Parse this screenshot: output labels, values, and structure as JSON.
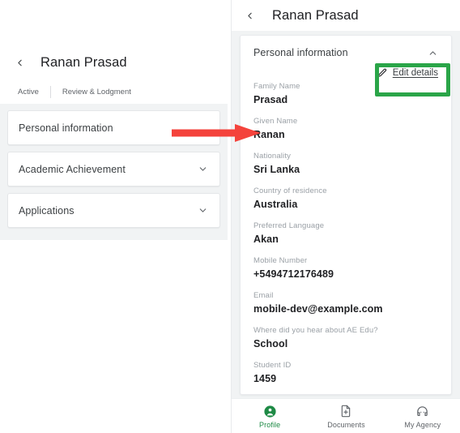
{
  "left_screen": {
    "back_icon": "chevron-left-icon",
    "title": "Ranan Prasad",
    "tabs": [
      {
        "label": "Active"
      },
      {
        "label": "Review & Lodgment"
      }
    ],
    "sections": [
      {
        "label": "Personal information",
        "icon": ""
      },
      {
        "label": "Academic Achievement",
        "icon": "chevron-down-icon"
      },
      {
        "label": "Applications",
        "icon": "chevron-down-icon"
      }
    ]
  },
  "right_screen": {
    "back_icon": "chevron-left-icon",
    "title": "Ranan Prasad",
    "card": {
      "title": "Personal information",
      "collapse_icon": "chevron-up-icon",
      "edit": {
        "icon": "pencil-icon",
        "label": "Edit details"
      },
      "fields": [
        {
          "label": "Family Name",
          "value": "Prasad"
        },
        {
          "label": "Given Name",
          "value": "Ranan"
        },
        {
          "label": "Nationality",
          "value": "Sri Lanka"
        },
        {
          "label": "Country of residence",
          "value": "Australia"
        },
        {
          "label": "Preferred Language",
          "value": "Akan"
        },
        {
          "label": "Mobile Number",
          "value": "+5494712176489"
        },
        {
          "label": "Email",
          "value": "mobile-dev@example.com"
        },
        {
          "label": "Where did you hear about AE Edu?",
          "value": "School"
        },
        {
          "label": "Student ID",
          "value": "1459"
        }
      ]
    },
    "bottom_nav": [
      {
        "label": "Profile",
        "icon": "person-circle-icon",
        "active": true
      },
      {
        "label": "Documents",
        "icon": "document-add-icon",
        "active": false
      },
      {
        "label": "My Agency",
        "icon": "headset-agent-icon",
        "active": false
      }
    ]
  },
  "annotations": {
    "highlight_box": {
      "name": "edit-details-highlight",
      "color": "#2aa548"
    },
    "pointer_arrow": {
      "name": "given-name-arrow",
      "color": "#f4433c"
    }
  }
}
